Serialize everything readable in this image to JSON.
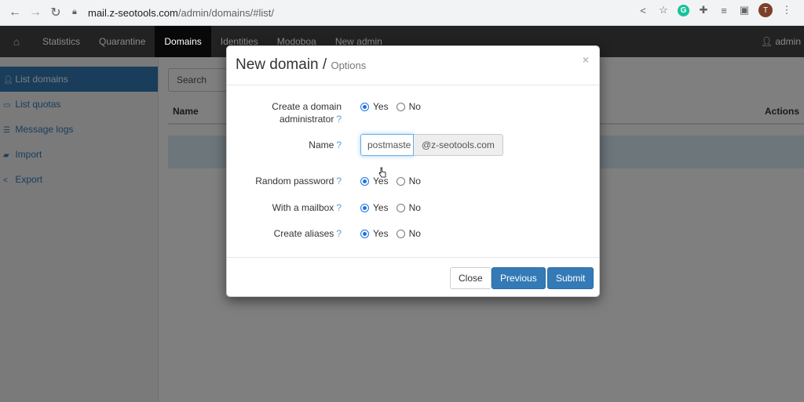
{
  "browser": {
    "url_host": "mail.z-seotools.com",
    "url_path": "/admin/domains/#list/",
    "profile_initial": "T",
    "grammarly_letter": "G"
  },
  "navbar": {
    "items": [
      "Statistics",
      "Quarantine",
      "Domains",
      "Identities",
      "Modoboa",
      "New admin"
    ],
    "active": "Domains",
    "user": "admin"
  },
  "sidebar": {
    "items": [
      {
        "label": "List domains",
        "icon": "user-icon",
        "active": true
      },
      {
        "label": "List quotas",
        "icon": "hdd-icon",
        "active": false
      },
      {
        "label": "Message logs",
        "icon": "list-icon",
        "active": false
      },
      {
        "label": "Import",
        "icon": "folder-icon",
        "active": false
      },
      {
        "label": "Export",
        "icon": "share-icon",
        "active": false
      }
    ]
  },
  "main": {
    "search_placeholder": "Search",
    "col_name": "Name",
    "col_actions": "Actions"
  },
  "modal": {
    "title": "New domain /",
    "subtitle": "Options",
    "close": "×",
    "fields": {
      "create_admin_label": "Create a domain administrator",
      "create_admin_line1": "Create a domain",
      "create_admin_line2": "administrator",
      "name_label": "Name",
      "name_value": "postmaste",
      "name_suffix": "@z-seotools.com",
      "random_password_label": "Random password",
      "with_mailbox_label": "With a mailbox",
      "create_aliases_label": "Create aliases",
      "help": "?",
      "yes": "Yes",
      "no": "No"
    },
    "buttons": {
      "close": "Close",
      "previous": "Previous",
      "submit": "Submit"
    }
  }
}
